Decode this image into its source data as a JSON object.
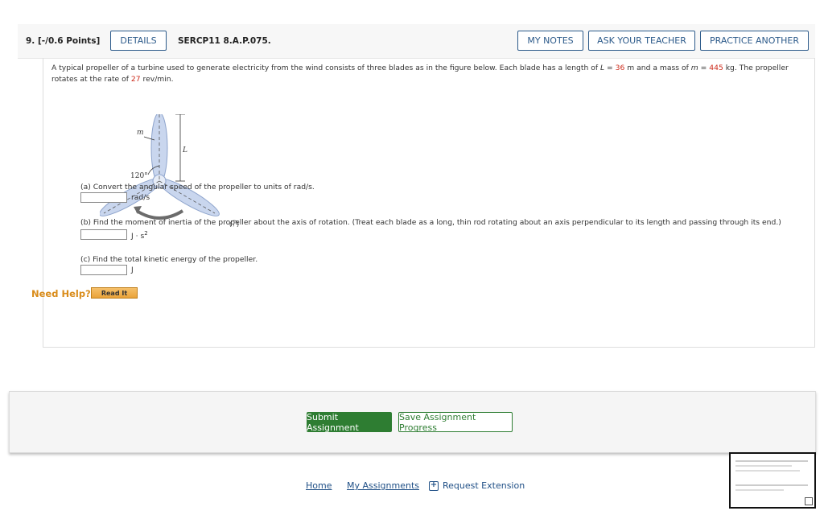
{
  "question": {
    "number": "9.",
    "points": "[-/0.6 Points]",
    "details_label": "DETAILS",
    "id": "SERCP11 8.A.P.075.",
    "my_notes_label": "MY NOTES",
    "ask_teacher_label": "ASK YOUR TEACHER",
    "practice_another_label": "PRACTICE ANOTHER"
  },
  "prompt": {
    "text_1": "A typical propeller of a turbine used to generate electricity from the wind consists of three blades as in the figure below. Each blade has a length of ",
    "L_symbol": "L",
    "eq1": " = ",
    "L_value": "36",
    "text_2": " m and a mass of ",
    "m_symbol": "m",
    "eq2": " = ",
    "m_value": "445",
    "text_3": " kg. The propeller rotates at the rate of ",
    "rate_value": "27",
    "text_4": " rev/min."
  },
  "figure": {
    "label_m": "m",
    "label_L": "L",
    "label_angle": "120°",
    "info_icon": "i"
  },
  "parts": {
    "a": {
      "text": "(a) Convert the angular speed of the propeller to units of rad/s.",
      "unit": "rad/s"
    },
    "b": {
      "text": "(b) Find the moment of inertia of the propeller about the axis of rotation. (Treat each blade as a long, thin rod rotating about an axis perpendicular to its length and passing through its end.)",
      "unit": "J · s",
      "unit_sup": "2"
    },
    "c": {
      "text": "(c) Find the total kinetic energy of the propeller.",
      "unit": "J"
    }
  },
  "help": {
    "label": "Need Help?",
    "read_it": "Read It"
  },
  "submission": {
    "submit_label": "Submit Assignment",
    "save_label": "Save Assignment Progress"
  },
  "footer": {
    "home": "Home",
    "my_assignments": "My Assignments",
    "request_extension": "Request Extension"
  },
  "colors": {
    "accent": "#2c5a8a",
    "value_red": "#cc2a1a",
    "submit_green": "#2e7d32",
    "help_orange": "#d98c1a"
  }
}
